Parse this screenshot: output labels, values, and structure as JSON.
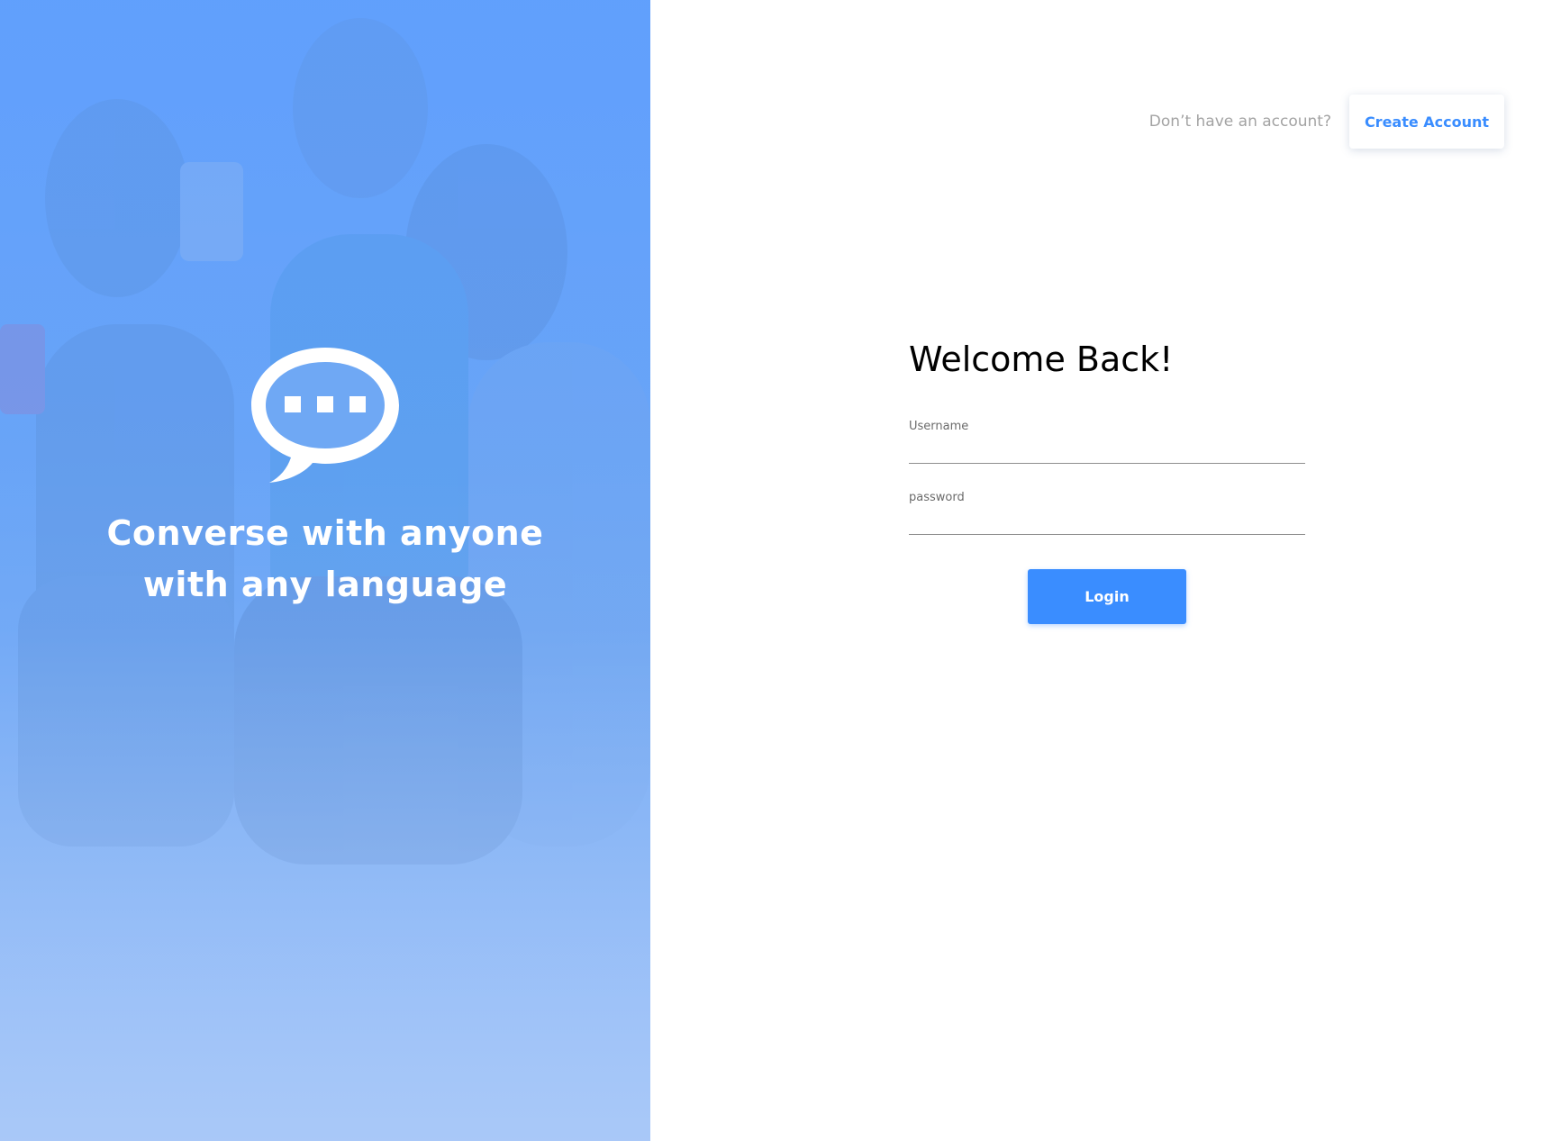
{
  "hero": {
    "icon": "chat-bubble-icon",
    "tagline_line1": "Converse with anyone",
    "tagline_line2": "with any language",
    "overlay_color": "#3a8dff"
  },
  "header": {
    "prompt": "Don’t have an account?",
    "create_account_label": "Create Account"
  },
  "form": {
    "title": "Welcome Back!",
    "username_label": "Username",
    "username_value": "",
    "password_label": "password",
    "password_value": "",
    "login_label": "Login"
  },
  "colors": {
    "accent": "#3a8dff",
    "muted_text": "#a3a3a3"
  }
}
